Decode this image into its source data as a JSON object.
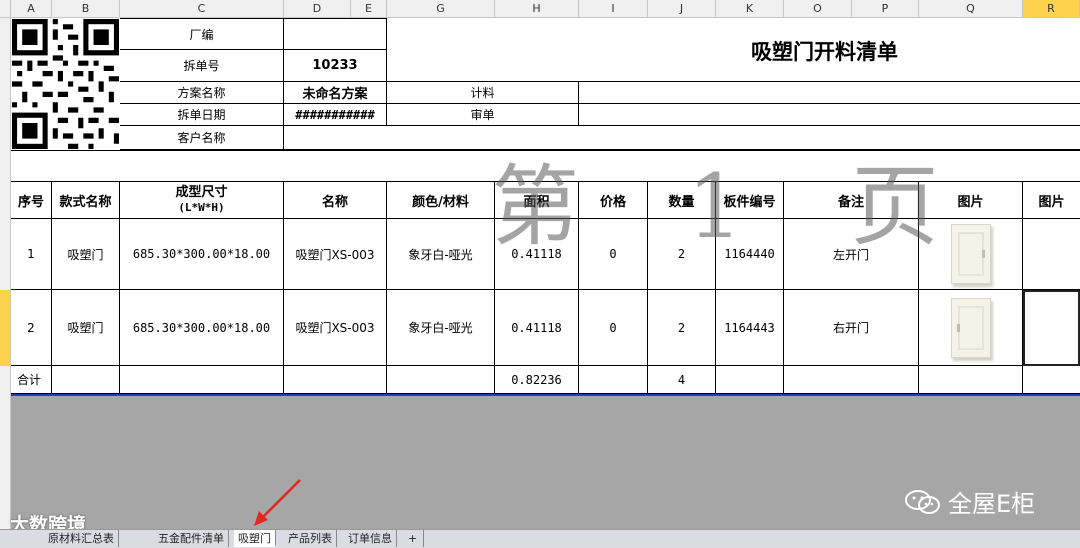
{
  "columns": [
    "A",
    "B",
    "C",
    "D",
    "E",
    "G",
    "H",
    "I",
    "J",
    "K",
    "O",
    "P",
    "Q",
    "R"
  ],
  "header_block": {
    "factory_label": "厂编",
    "order_no_label": "拆单号",
    "order_no": "10233",
    "scheme_label": "方案名称",
    "scheme_value": "未命名方案",
    "date_label": "拆单日期",
    "date_value": "###########",
    "customer_label": "客户名称",
    "billing_label": "计料",
    "review_label": "审单",
    "title": "吸塑门开料清单"
  },
  "watermark": "第 1 页",
  "table": {
    "headers": [
      "序号",
      "款式名称",
      "成型尺寸",
      "名称",
      "颜色/材料",
      "面积",
      "价格",
      "数量",
      "板件编号",
      "备注",
      "图片",
      "图片"
    ],
    "size_sub": "(L*W*H)",
    "rows": [
      {
        "no": "1",
        "style": "吸塑门",
        "size": "685.30*300.00*18.00",
        "name": "吸塑门XS-003",
        "color": "象牙白-哑光",
        "area": "0.41118",
        "price": "0",
        "qty": "2",
        "part": "1164440",
        "note": "左开门"
      },
      {
        "no": "2",
        "style": "吸塑门",
        "size": "685.30*300.00*18.00",
        "name": "吸塑门XS-003",
        "color": "象牙白-哑光",
        "area": "0.41118",
        "price": "0",
        "qty": "2",
        "part": "1164443",
        "note": "右开门"
      }
    ],
    "total_label": "合计",
    "total_area": "0.82236",
    "total_qty": "4"
  },
  "sheet_tabs": [
    "原材料汇总表",
    "五金配件清单",
    "吸塑门",
    "产品列表",
    "订单信息"
  ],
  "active_tab": "吸塑门",
  "watermarks": {
    "left": "大数跨境",
    "right": "全屋E柜"
  }
}
